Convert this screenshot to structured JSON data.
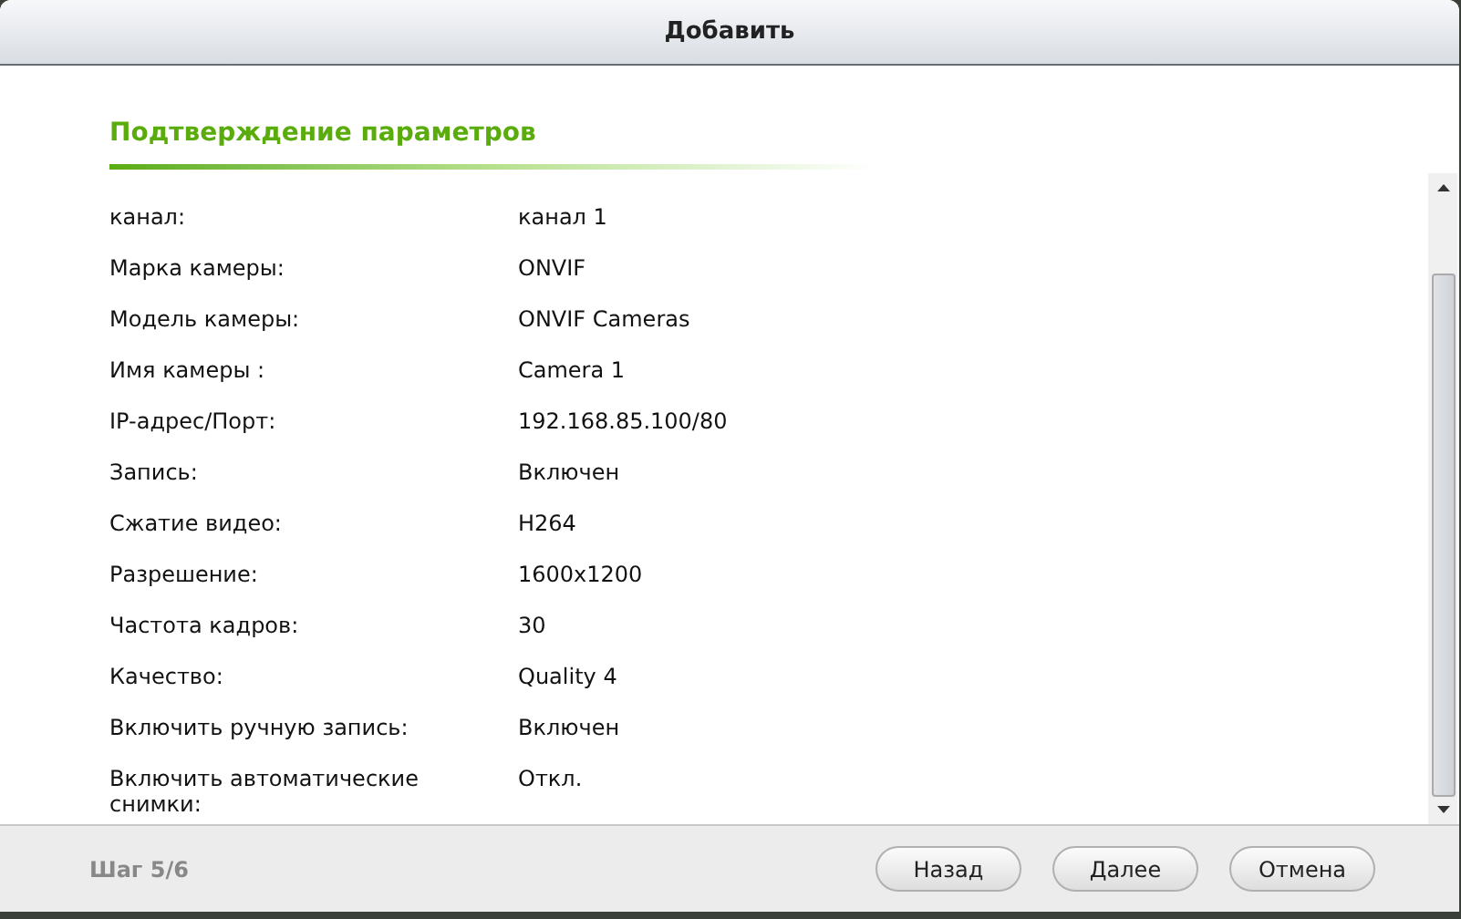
{
  "window": {
    "title": "Добавить"
  },
  "section": {
    "title": "Подтверждение параметров"
  },
  "rows": [
    {
      "label": "канал:",
      "value": "канал 1"
    },
    {
      "label": "Марка камеры:",
      "value": "ONVIF"
    },
    {
      "label": "Модель камеры:",
      "value": "ONVIF Cameras"
    },
    {
      "label": "Имя камеры :",
      "value": "Camera 1"
    },
    {
      "label": "IP-адрес/Порт:",
      "value": "192.168.85.100/80"
    },
    {
      "label": "Запись:",
      "value": "Включен"
    },
    {
      "label": "Сжатие видео:",
      "value": "H264"
    },
    {
      "label": "Разрешение:",
      "value": "1600x1200"
    },
    {
      "label": "Частота кадров:",
      "value": "30"
    },
    {
      "label": "Качество:",
      "value": "Quality 4"
    },
    {
      "label": "Включить ручную запись:",
      "value": "Включен"
    },
    {
      "label": "Включить автоматические снимки:",
      "value": "Откл."
    }
  ],
  "footer": {
    "step": "Шаг 5/6",
    "buttons": [
      "Назад",
      "Далее",
      "Отмена"
    ]
  }
}
